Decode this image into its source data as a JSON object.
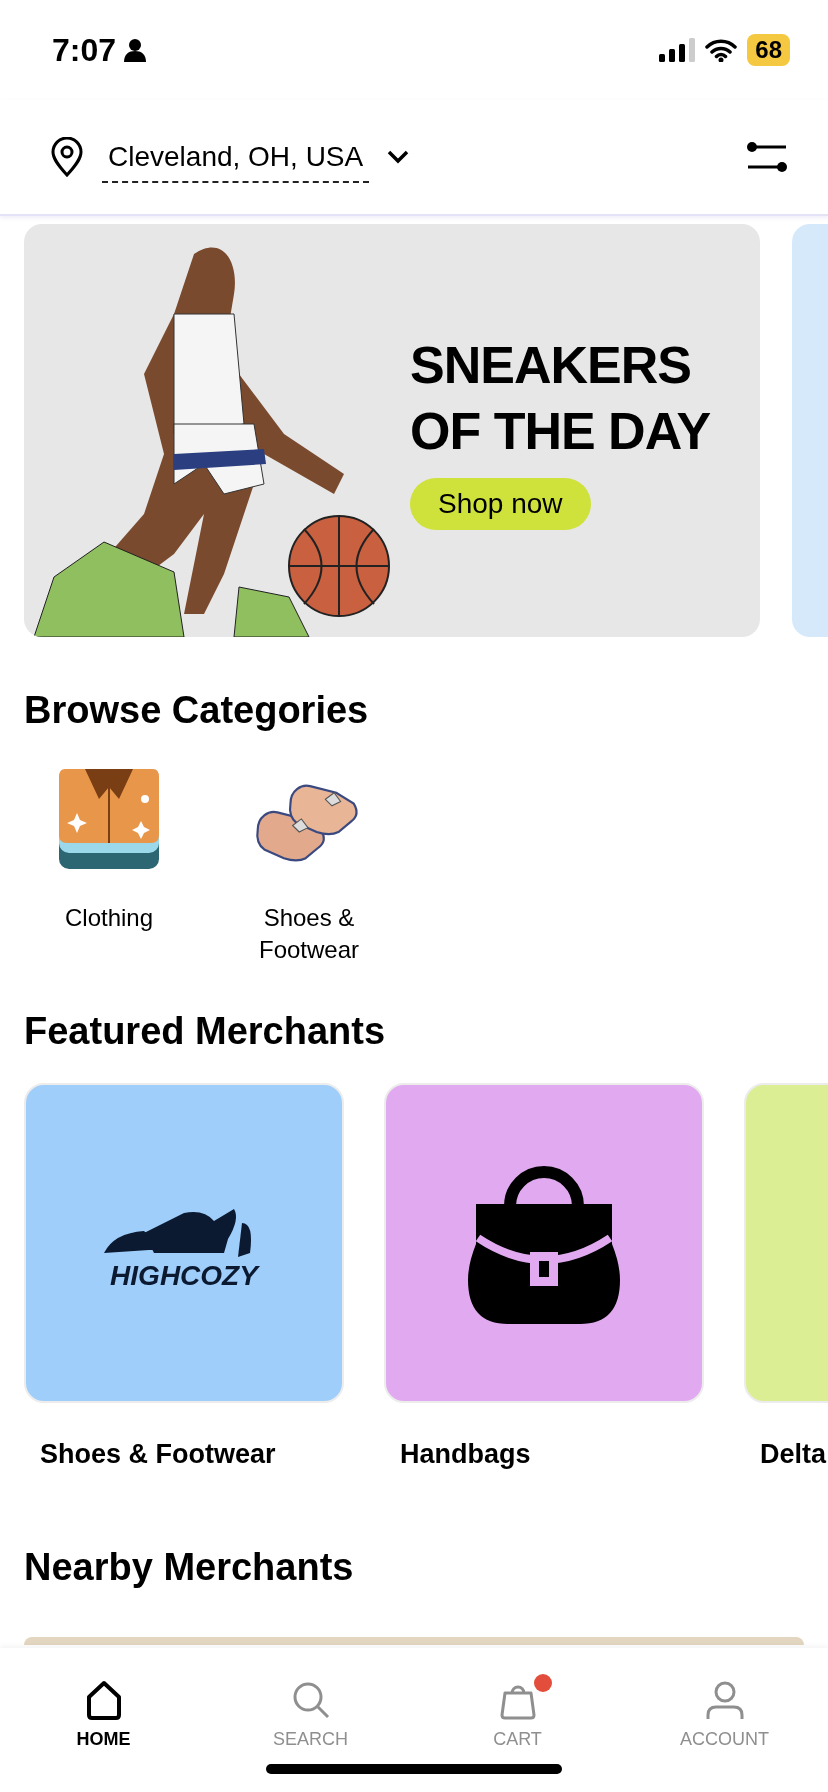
{
  "status_bar": {
    "time": "7:07",
    "battery": "68"
  },
  "header": {
    "location": "Cleveland, OH, USA"
  },
  "banners": [
    {
      "kind": "promo",
      "title": "SNEAKERS OF THE DAY",
      "button": "Shop now"
    },
    {
      "kind": "peek"
    }
  ],
  "categories": {
    "title": "Browse Categories",
    "items": [
      {
        "kind": "clothing",
        "label": "Clothing"
      },
      {
        "kind": "shoes",
        "label": "Shoes & Footwear"
      }
    ]
  },
  "featured": {
    "title": "Featured Merchants",
    "items": [
      {
        "kind": "sneaker-logo",
        "name": "Shoes & Footwear",
        "color": "#a0cefa",
        "logo_text": "HIGHCOZY"
      },
      {
        "kind": "handbag",
        "name": "Handbags",
        "color": "#e1aaf0"
      },
      {
        "kind": "blank",
        "name": "Delta",
        "color": "#dbee94"
      }
    ]
  },
  "nearby": {
    "title": "Nearby Merchants"
  },
  "tab_bar": [
    {
      "kind": "home",
      "label": "HOME",
      "selected": true,
      "badge": false
    },
    {
      "kind": "search",
      "label": "SEARCH",
      "selected": false,
      "badge": false
    },
    {
      "kind": "cart",
      "label": "CART",
      "selected": false,
      "badge": true
    },
    {
      "kind": "account",
      "label": "ACCOUNT",
      "selected": false,
      "badge": false
    }
  ]
}
